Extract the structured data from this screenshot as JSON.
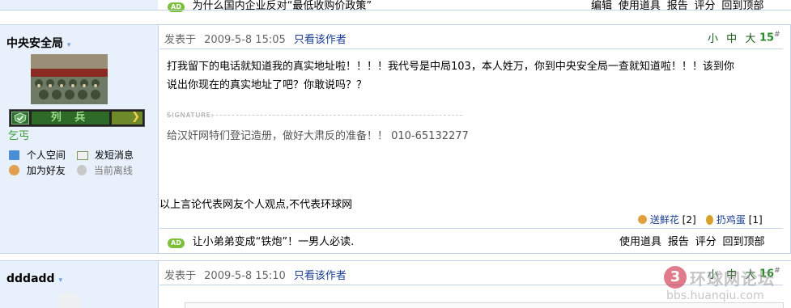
{
  "top_row": {
    "ad_text": "为什么国内企业反对“最低收购价政策”",
    "actions": [
      "编辑",
      "使用道具",
      "报告",
      "评分",
      "回到顶部"
    ]
  },
  "post1": {
    "username": "中央安全局",
    "avatar_icon": "military-parade-photo",
    "rank_label": "列 兵",
    "user_group": "乞丐",
    "profile_links": [
      "个人空间",
      "发短消息",
      "加为好友",
      "当前离线"
    ],
    "posted_label": "发表于",
    "posted_time": "2009-5-8 15:05",
    "only_author": "只看该作者",
    "font_sizes": [
      "小",
      "中",
      "大"
    ],
    "floor": "15",
    "floor_symbol": "#",
    "content_line1": "打我留下的电话就知道我的真实地址啦！！！！我代号是中局103，本人姓万，你到中央安全局一查就知道啦！！！该到你",
    "content_line2": "说出你现在的真实地址了吧？你敢说吗？？",
    "signature_label": "SIGNATURE:",
    "signature_text": "给汉奸网特们登记造册，做好大肃反的准备！！ 010-65132277",
    "disclaimer": "以上言论代表网友个人观点,不代表环球网",
    "flower_label": "送鲜花",
    "flower_count": "[2]",
    "egg_label": "扔鸡蛋",
    "egg_count": "[1]",
    "ad_text": "让小弟弟变成“铁炮”！一男人必读.",
    "actions": [
      "使用道具",
      "报告",
      "评分",
      "回到顶部"
    ]
  },
  "post2": {
    "username": "dddadd",
    "posted_label": "发表于",
    "posted_time": "2009-5-8 15:10",
    "only_author": "只看该作者",
    "font_sizes": [
      "小",
      "中",
      "大"
    ],
    "floor": "16",
    "floor_symbol": "#"
  },
  "watermark": {
    "logo_text": "环球网论坛",
    "url": "bbs.huanqiu.com"
  },
  "colors": {
    "accent_blue": "#1a3e94",
    "floor_green": "#2a8a2a",
    "sidebar_bg": "#e8f0fb"
  }
}
